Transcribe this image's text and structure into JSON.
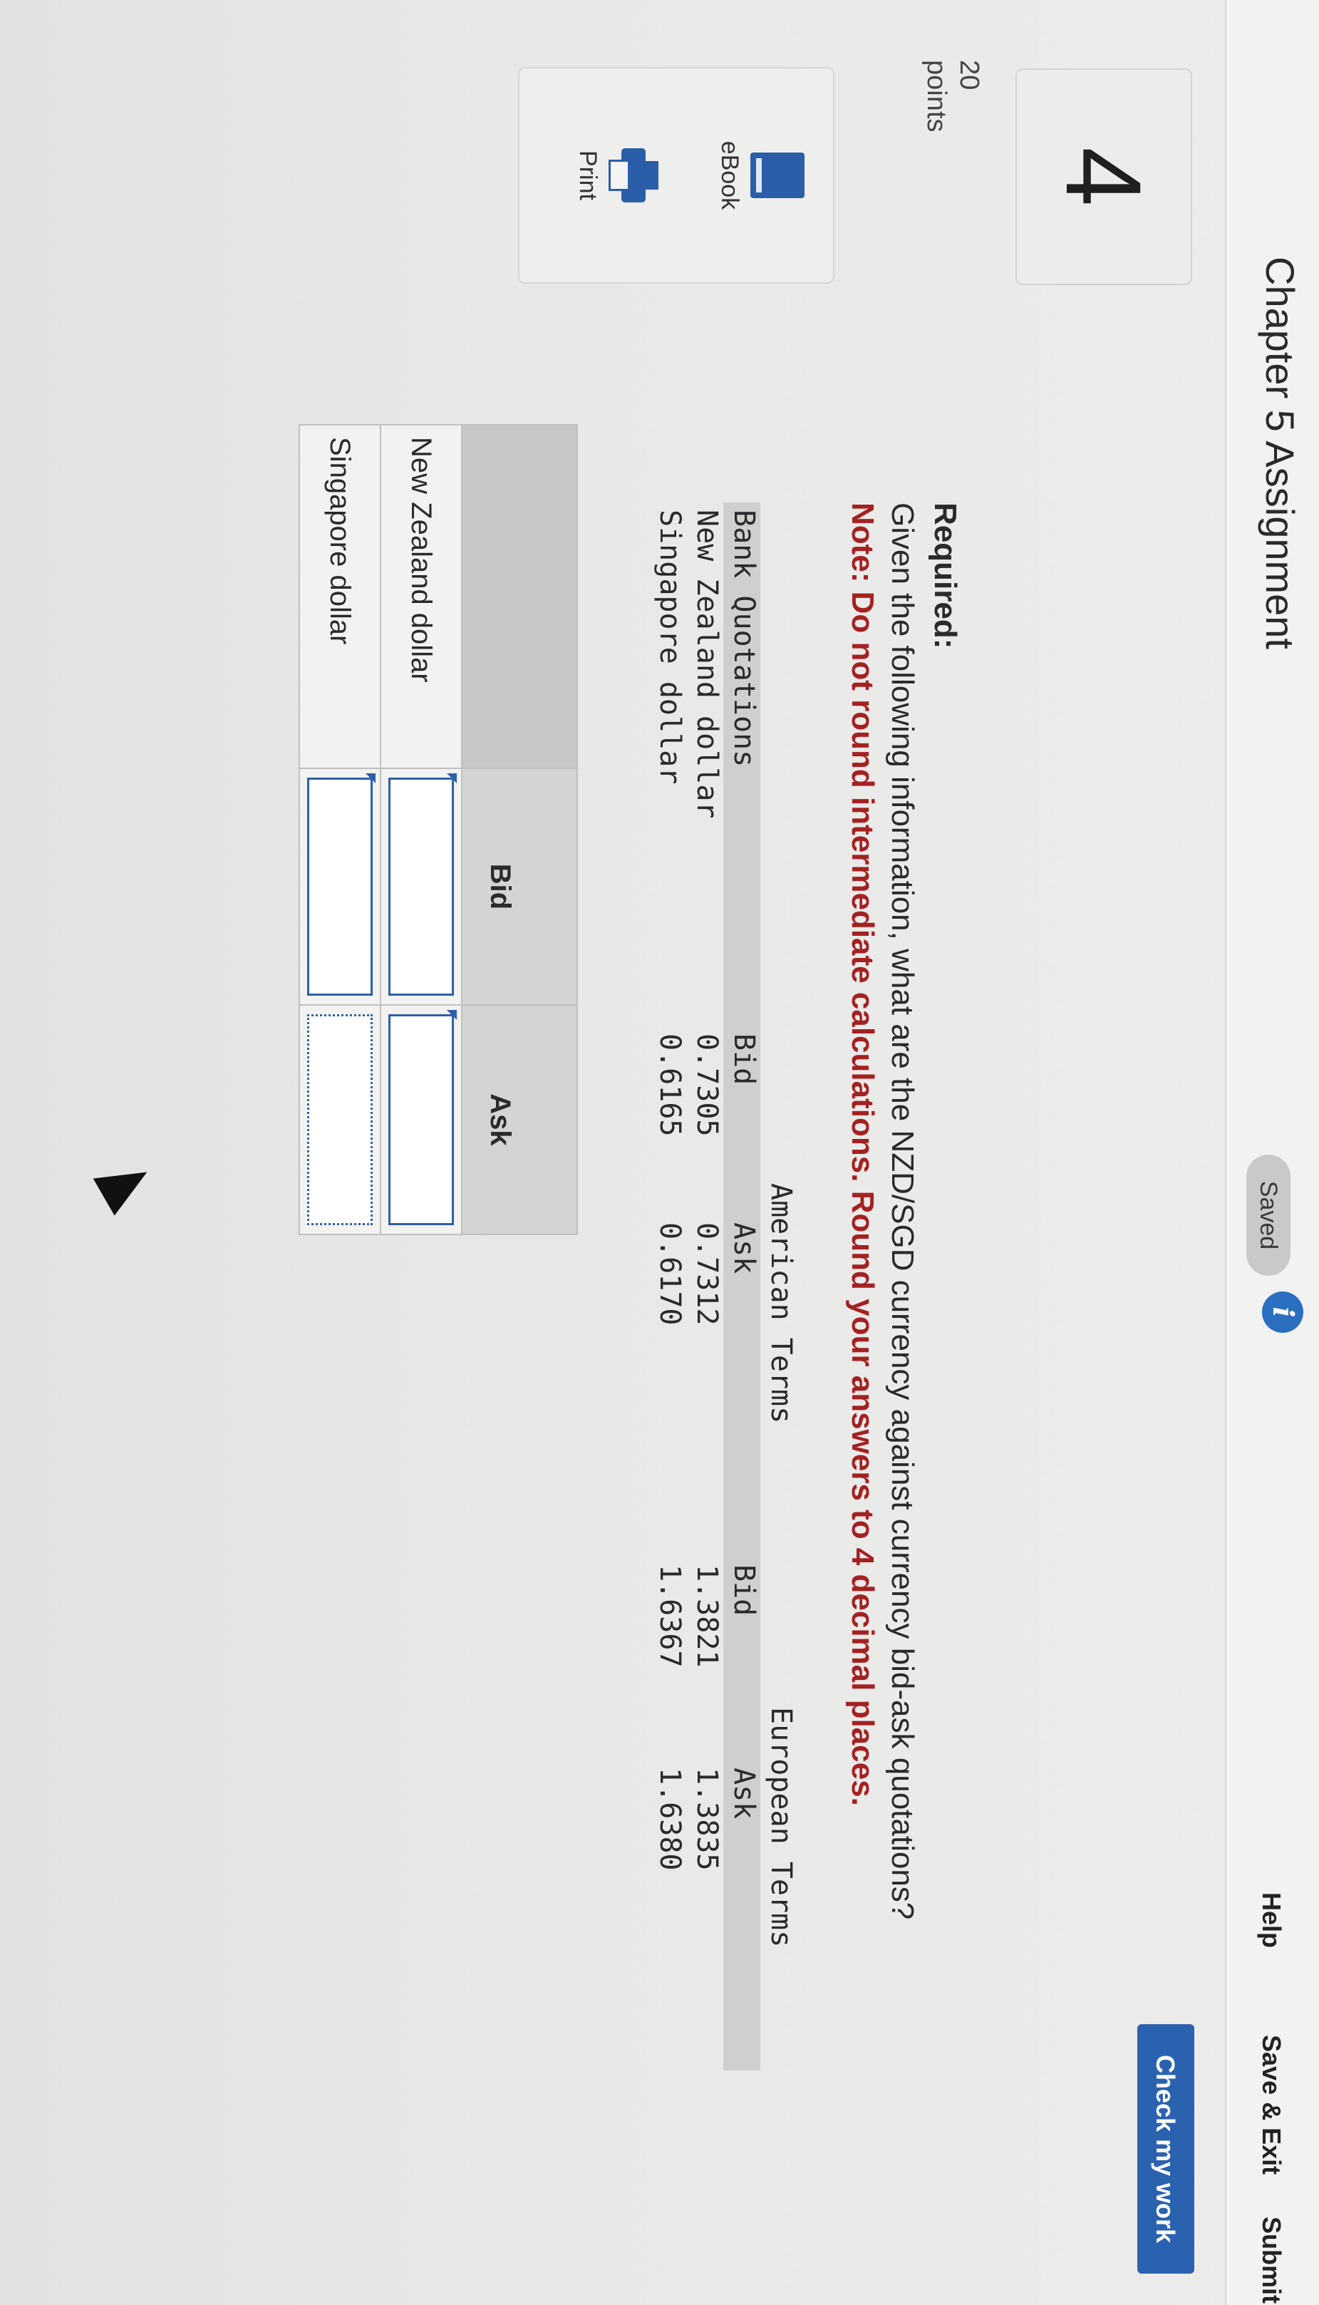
{
  "header": {
    "title": "Chapter 5 Assignment",
    "info_icon": "i",
    "saved_label": "Saved",
    "help_label": "Help",
    "save_exit_label": "Save & Exit",
    "submit_label": "Submit"
  },
  "question": {
    "number": "4",
    "points_value": "20",
    "points_label": "points",
    "required_label": "Required:",
    "prompt": "Given the following information, what are the NZD/SGD currency against currency bid-ask quotations?",
    "note": "Note: Do not round intermediate calculations. Round your answers to 4 decimal places.",
    "check_button": "Check my work"
  },
  "tools": {
    "ebook_label": "eBook",
    "print_label": "Print"
  },
  "quotes_table": {
    "american_terms": "American Terms",
    "european_terms": "European Terms",
    "col_label": "Bank Quotations",
    "bid": "Bid",
    "ask": "Ask",
    "rows": [
      {
        "name": "New Zealand dollar",
        "am_bid": "0.7305",
        "am_ask": "0.7312",
        "eu_bid": "1.3821",
        "eu_ask": "1.3835"
      },
      {
        "name": "Singapore dollar",
        "am_bid": "0.6165",
        "am_ask": "0.6170",
        "eu_bid": "1.6367",
        "eu_ask": "1.6380"
      }
    ]
  },
  "answer_table": {
    "bid_header": "Bid",
    "ask_header": "Ask",
    "rows": [
      {
        "label": "New Zealand dollar",
        "bid_value": "",
        "ask_value": ""
      },
      {
        "label": "Singapore dollar",
        "bid_value": "",
        "ask_value": ""
      }
    ]
  },
  "colors": {
    "accent": "#2b62b0",
    "note": "#a42122",
    "info_icon": "#2a6fc0"
  }
}
